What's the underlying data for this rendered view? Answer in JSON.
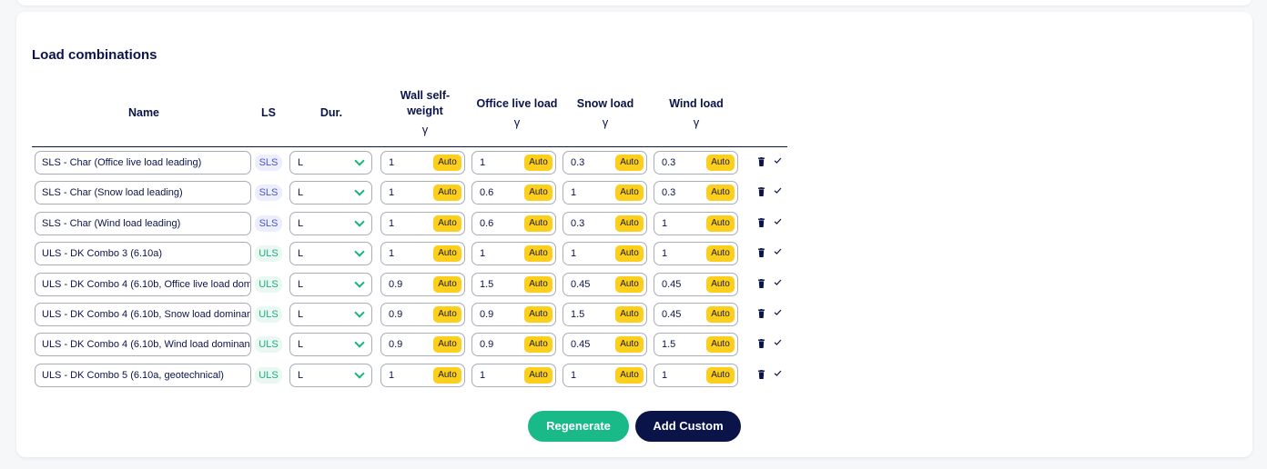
{
  "title": "Load combinations",
  "headers": {
    "name": "Name",
    "ls": "LS",
    "dur": "Dur.",
    "wall_line1": "Wall self-",
    "wall_line2": "weight",
    "office": "Office live load",
    "snow": "Snow load",
    "wind": "Wind load",
    "gamma": "γ"
  },
  "auto_label": "Auto",
  "rows": [
    {
      "name": "SLS - Char (Office live load leading)",
      "ls": "SLS",
      "dur": "L",
      "wall": "1",
      "office": "1",
      "snow": "0.3",
      "wind": "0.3"
    },
    {
      "name": "SLS - Char (Snow load leading)",
      "ls": "SLS",
      "dur": "L",
      "wall": "1",
      "office": "0.6",
      "snow": "1",
      "wind": "0.3"
    },
    {
      "name": "SLS - Char (Wind load leading)",
      "ls": "SLS",
      "dur": "L",
      "wall": "1",
      "office": "0.6",
      "snow": "0.3",
      "wind": "1"
    },
    {
      "name": "ULS - DK Combo 3 (6.10a)",
      "ls": "ULS",
      "dur": "L",
      "wall": "1",
      "office": "1",
      "snow": "1",
      "wind": "1"
    },
    {
      "name": "ULS - DK Combo 4 (6.10b, Office live load dom",
      "ls": "ULS",
      "dur": "L",
      "wall": "0.9",
      "office": "1.5",
      "snow": "0.45",
      "wind": "0.45"
    },
    {
      "name": "ULS - DK Combo 4 (6.10b, Snow load dominan",
      "ls": "ULS",
      "dur": "L",
      "wall": "0.9",
      "office": "0.9",
      "snow": "1.5",
      "wind": "0.45"
    },
    {
      "name": "ULS - DK Combo 4 (6.10b, Wind load dominan",
      "ls": "ULS",
      "dur": "L",
      "wall": "0.9",
      "office": "0.9",
      "snow": "0.45",
      "wind": "1.5"
    },
    {
      "name": "ULS - DK Combo 5 (6.10a, geotechnical)",
      "ls": "ULS",
      "dur": "L",
      "wall": "1",
      "office": "1",
      "snow": "1",
      "wind": "1"
    }
  ],
  "buttons": {
    "regenerate": "Regenerate",
    "add_custom": "Add Custom"
  },
  "icons": {
    "dur_chevron": "chevron-down-icon",
    "row_delete": "trash-icon",
    "row_confirm": "check-icon"
  },
  "colors": {
    "primary_navy": "#0b1448",
    "accent_green": "#19b988",
    "auto_yellow": "#fccf1d",
    "sls_badge": "#eceefc",
    "uls_badge": "#e9f8f2"
  }
}
